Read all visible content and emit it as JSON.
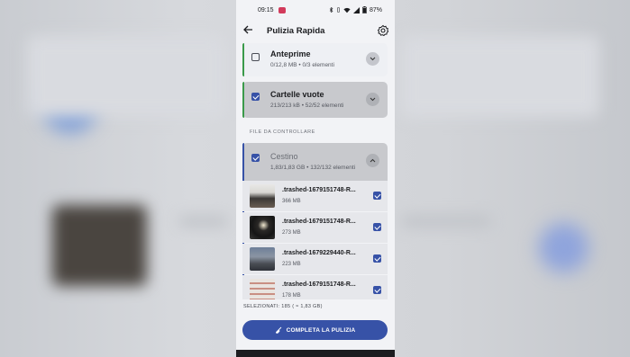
{
  "status_bar": {
    "time": "09:15",
    "battery": "87%"
  },
  "app_bar": {
    "title": "Pulizia Rapida",
    "back_icon": "arrow-left-icon",
    "settings_icon": "gear-icon"
  },
  "categories": [
    {
      "name": "Anteprime",
      "detail": "0/12,8 MB • 0/3 elementi",
      "checked": false,
      "accent": "#3a9a4a",
      "expanded": false
    },
    {
      "name": "Cartelle vuote",
      "detail": "213/213 kB • 52/52 elementi",
      "checked": true,
      "accent": "#3a9a4a",
      "expanded": false
    }
  ],
  "section_label": "FILE DA CONTROLLARE",
  "trash": {
    "name": "Cestino",
    "detail": "1,83/1,83 GB • 132/132 elementi",
    "checked": true,
    "expanded": true,
    "accent": "#3752a7"
  },
  "trash_files": [
    {
      "name": ".trashed-1679151748-R...",
      "size": "366 MB",
      "checked": true
    },
    {
      "name": ".trashed-1679151748-R...",
      "size": "273 MB",
      "checked": true
    },
    {
      "name": ".trashed-1679229440-R...",
      "size": "223 MB",
      "checked": true
    },
    {
      "name": ".trashed-1679151748-R...",
      "size": "178 MB",
      "checked": true
    }
  ],
  "footer": {
    "selected_text": "SELEZIONATI: 185 ( ≈ 1,83 GB)",
    "button_label": "COMPLETA LA PULIZIA",
    "button_icon": "broom-icon"
  },
  "colors": {
    "primary": "#3752a7",
    "success_accent": "#3a9a4a",
    "background": "#f2f3f6"
  }
}
